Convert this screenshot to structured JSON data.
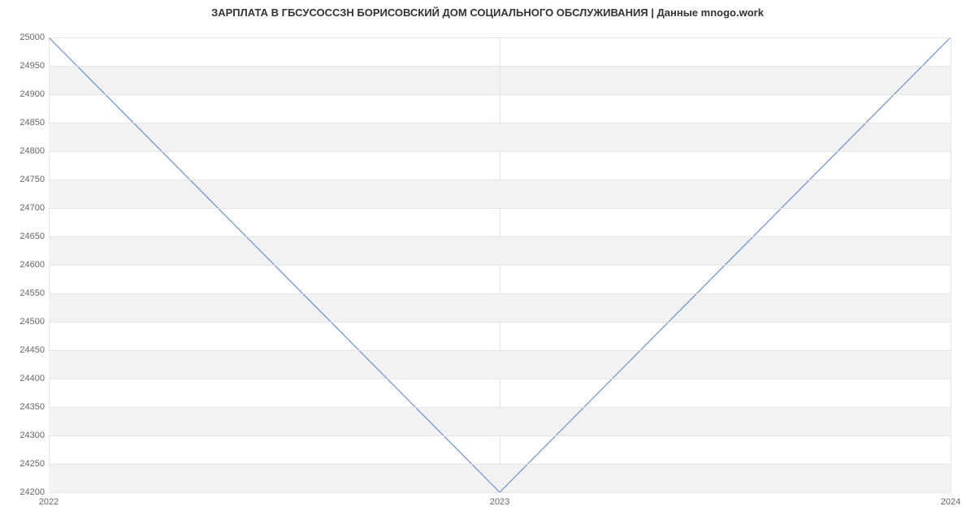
{
  "chart_data": {
    "type": "line",
    "title": "ЗАРПЛАТА В ГБСУСОССЗН БОРИСОВСКИЙ ДОМ СОЦИАЛЬНОГО ОБСЛУЖИВАНИЯ | Данные mnogo.work",
    "xlabel": "",
    "ylabel": "",
    "x": [
      "2022",
      "2023",
      "2024"
    ],
    "values": [
      25000,
      24200,
      25000
    ],
    "ylim": [
      24200,
      25000
    ],
    "yticks": [
      24200,
      24250,
      24300,
      24350,
      24400,
      24450,
      24500,
      24550,
      24600,
      24650,
      24700,
      24750,
      24800,
      24850,
      24900,
      24950,
      25000
    ],
    "xticks": [
      "2022",
      "2023",
      "2024"
    ],
    "line_color": "#6b8fd6",
    "band_color": "#f2f2f2"
  }
}
